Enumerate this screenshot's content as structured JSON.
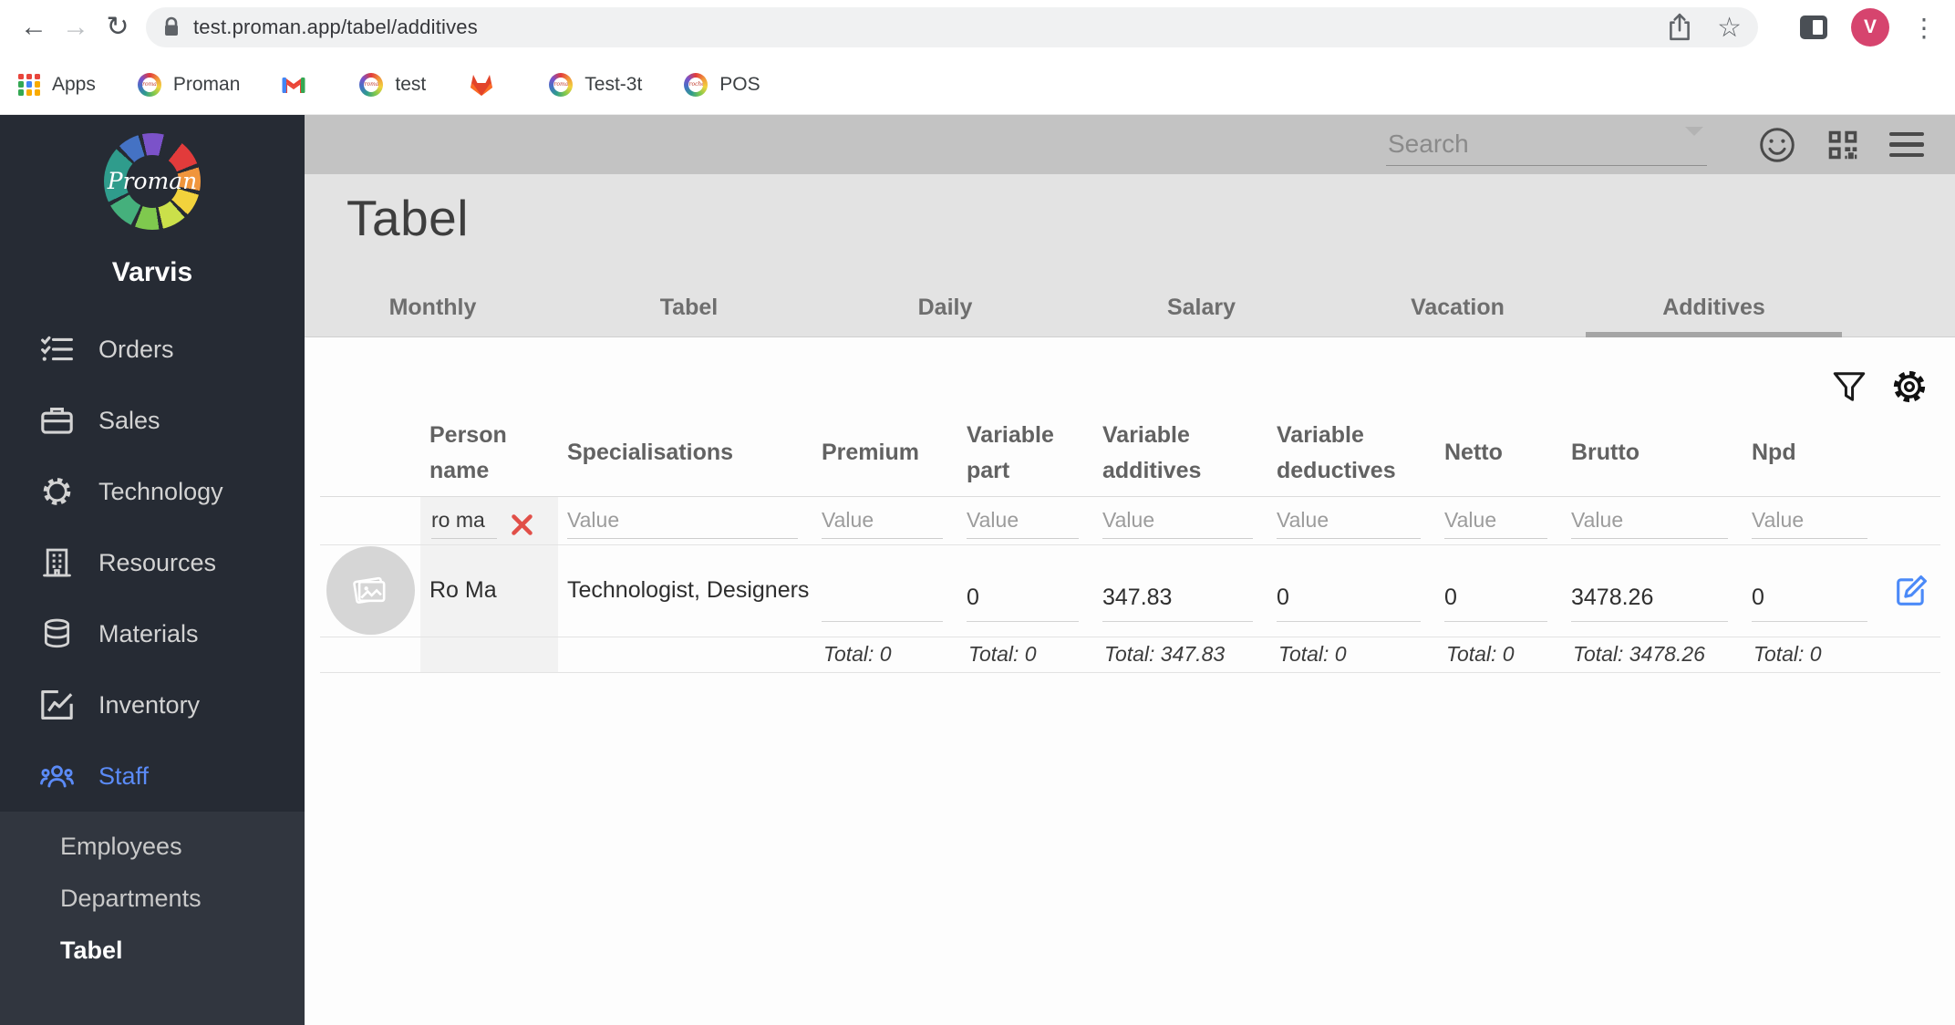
{
  "colors": {
    "accent_blue": "#5b8bf7",
    "sidebar_bg": "#262b34",
    "topbar_gray": "#c3c3c3",
    "header_gray": "#e3e3e3",
    "profile_pink": "#d6446e",
    "clear_red": "#e14f48"
  },
  "browser": {
    "nav": {
      "back": "←",
      "forward": "→",
      "reload": "↻"
    },
    "url": "test.proman.app/tabel/additives",
    "star": "☆",
    "menu_dots": "⋮",
    "profile_initial": "V",
    "bookmarks": [
      {
        "label": "Apps"
      },
      {
        "label": "Proman"
      },
      {
        "label": ""
      },
      {
        "label": "test"
      },
      {
        "label": ""
      },
      {
        "label": "Test-3t"
      },
      {
        "label": "POS"
      }
    ]
  },
  "sidebar": {
    "logo_text": "Proman",
    "account_name": "Varvis",
    "items": [
      {
        "label": "Orders"
      },
      {
        "label": "Sales"
      },
      {
        "label": "Technology"
      },
      {
        "label": "Resources"
      },
      {
        "label": "Materials"
      },
      {
        "label": "Inventory"
      },
      {
        "label": "Staff",
        "active": true
      }
    ],
    "subitems": [
      {
        "label": "Employees"
      },
      {
        "label": "Departments"
      },
      {
        "label": "Tabel",
        "active": true
      }
    ]
  },
  "topbar": {
    "search_placeholder": "Search"
  },
  "page": {
    "title": "Tabel",
    "tabs": [
      {
        "label": "Monthly"
      },
      {
        "label": "Tabel"
      },
      {
        "label": "Daily"
      },
      {
        "label": "Salary"
      },
      {
        "label": "Vacation"
      },
      {
        "label": "Additives",
        "active": true
      }
    ]
  },
  "table": {
    "headers": {
      "person": "Person name",
      "specialisations": "Specialisations",
      "premium": "Premium",
      "variable_part": "Variable part",
      "variable_additives": "Variable additives",
      "variable_deductives": "Variable deductives",
      "netto": "Netto",
      "brutto": "Brutto",
      "npd": "Npd"
    },
    "filter_row": {
      "person_value": "ro ma",
      "value_placeholder": "Value"
    },
    "rows": [
      {
        "person_name": "Ro Ma",
        "specialisations": "Technologist, Designers",
        "premium": "",
        "variable_part": "0",
        "variable_additives": "347.83",
        "variable_deductives": "0",
        "netto": "0",
        "brutto": "3478.26",
        "npd": "0"
      }
    ],
    "totals": {
      "premium": "Total: 0",
      "variable_part": "Total: 0",
      "variable_additives": "Total: 347.83",
      "variable_deductives": "Total: 0",
      "netto": "Total: 0",
      "brutto": "Total: 3478.26",
      "npd": "Total: 0"
    }
  }
}
